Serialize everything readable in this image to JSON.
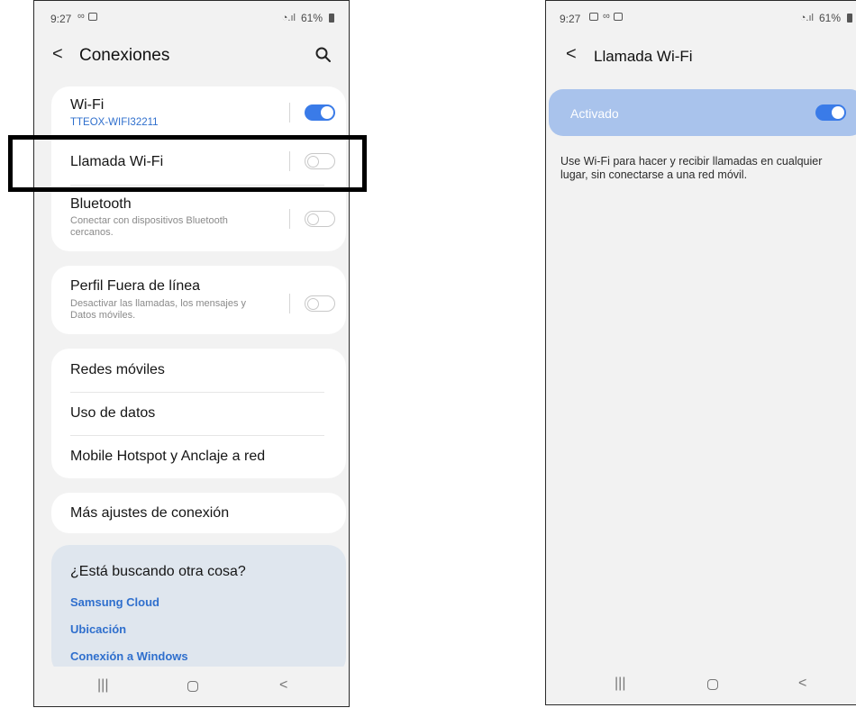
{
  "left": {
    "status": {
      "time": "9:27",
      "battery": "61%"
    },
    "header": {
      "title": "Conexiones",
      "back_glyph": "<"
    },
    "wifi": {
      "title": "Wi-Fi",
      "subtitle": "TTEOX-WIFI32211",
      "toggle": "on"
    },
    "wifi_call": {
      "title": "Llamada Wi-Fi",
      "toggle": "off"
    },
    "bluetooth": {
      "title": "Bluetooth",
      "subtitle": "Conectar con dispositivos Bluetooth cercanos.",
      "toggle": "off"
    },
    "offline": {
      "title": "Perfil Fuera de línea",
      "subtitle": "Desactivar las llamadas, los mensajes y Datos móviles.",
      "toggle": "off"
    },
    "mobile_networks": {
      "title": "Redes móviles"
    },
    "data_usage": {
      "title": "Uso de datos"
    },
    "hotspot": {
      "title": "Mobile Hotspot y Anclaje a red"
    },
    "more_settings": {
      "title": "Más ajustes de conexión"
    },
    "suggest": {
      "title": "¿Está buscando otra cosa?",
      "links": [
        "Samsung Cloud",
        "Ubicación",
        "Conexión a Windows"
      ]
    },
    "nav": {
      "recents": "|||",
      "back": "<"
    }
  },
  "right": {
    "status": {
      "time": "9:27",
      "battery": "61%"
    },
    "header": {
      "title": "Llamada Wi-Fi",
      "back_glyph": "<"
    },
    "banner": {
      "label": "Activado",
      "toggle": "on"
    },
    "description": "Use Wi-Fi para hacer y recibir llamadas en cualquier lugar, sin conectarse a una red móvil.",
    "nav": {
      "recents": "|||",
      "back": "<"
    }
  },
  "colors": {
    "accent": "#3a7be8",
    "link": "#2f6fcd",
    "banner": "#a9c3ec",
    "background": "#f2f2f2"
  }
}
